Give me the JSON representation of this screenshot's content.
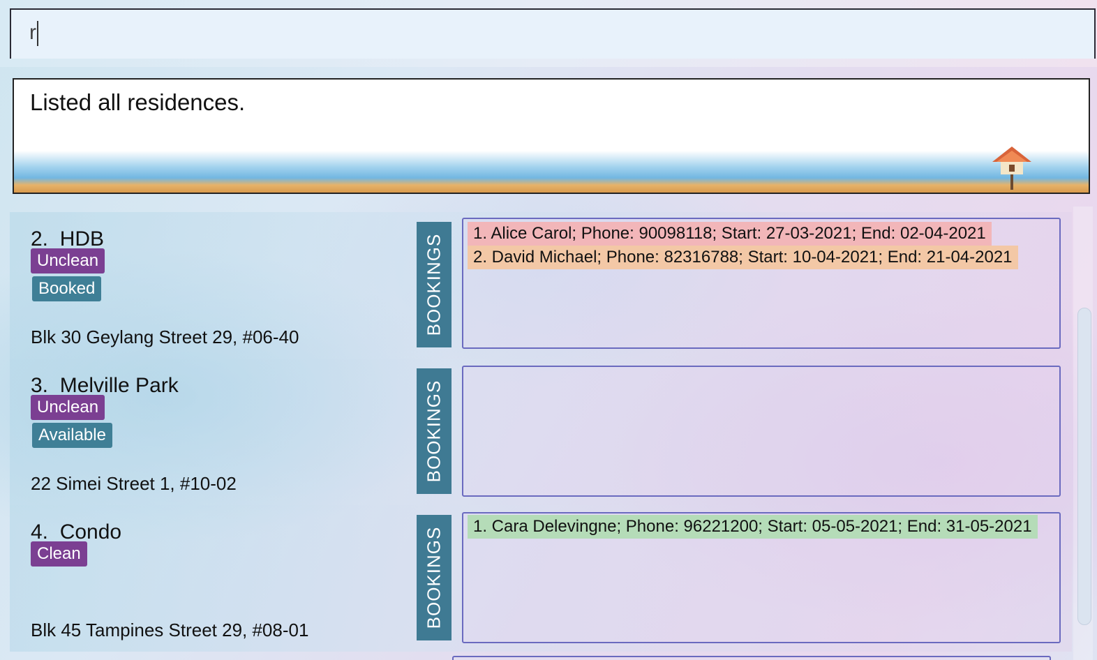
{
  "command": {
    "value": "r"
  },
  "result": {
    "message": "Listed all residences."
  },
  "residences": [
    {
      "index": "2.",
      "name": "HDB",
      "clean_tag": "Unclean",
      "status_tag": "Booked",
      "address": "Blk 30 Geylang Street 29, #06-40",
      "bookings_label": "BOOKINGS",
      "bookings": [
        {
          "text": "1. Alice Carol; Phone: 90098118; Start: 27-03-2021; End: 02-04-2021",
          "color": "#f2b6b9"
        },
        {
          "text": "2. David Michael; Phone: 82316788; Start: 10-04-2021; End: 21-04-2021",
          "color": "#f3c8a6"
        }
      ]
    },
    {
      "index": "3.",
      "name": "Melville Park",
      "clean_tag": "Unclean",
      "status_tag": "Available",
      "address": "22 Simei Street 1, #10-02",
      "bookings_label": "BOOKINGS",
      "bookings": []
    },
    {
      "index": "4.",
      "name": "Condo",
      "clean_tag": "Clean",
      "status_tag": "",
      "address": "Blk 45 Tampines Street 29, #08-01",
      "bookings_label": "BOOKINGS",
      "bookings": [
        {
          "text": "1. Cara Delevingne; Phone: 96221200; Start: 05-05-2021; End: 31-05-2021",
          "color": "#b5dcb8"
        }
      ]
    }
  ],
  "colors": {
    "clean_tag": "#7b3f92",
    "status_tag": "#3f7f96",
    "bookings_label": "#3f7a93",
    "bookings_border": "#6a6abf"
  }
}
